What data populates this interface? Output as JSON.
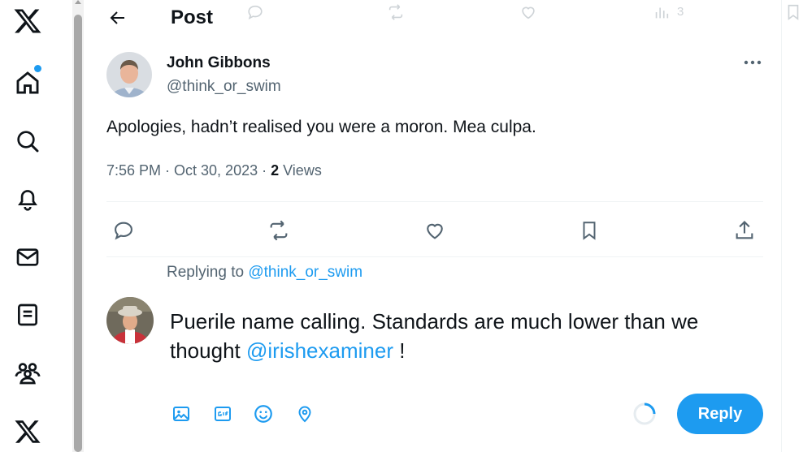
{
  "nav": {
    "items": [
      {
        "name": "x-logo-icon"
      },
      {
        "name": "home-icon"
      },
      {
        "name": "search-icon"
      },
      {
        "name": "notifications-icon"
      },
      {
        "name": "messages-icon"
      },
      {
        "name": "lists-icon"
      },
      {
        "name": "communities-icon"
      },
      {
        "name": "premium-x-icon"
      }
    ],
    "notification_dot_color": "#1d9bf0"
  },
  "header": {
    "title": "Post"
  },
  "ghost_bar": {
    "views_count": "3"
  },
  "tweet": {
    "author_name": "John Gibbons",
    "author_handle": "@think_or_swim",
    "text": "Apologies, hadn’t realised you were a moron. Mea culpa.",
    "time": "7:56 PM · Oct 30, 2023 · ",
    "views_count": "2",
    "views_label": " Views"
  },
  "reply": {
    "replying_to_prefix": "Replying to ",
    "replying_to_handle": "@think_or_swim",
    "text_before": "Puerile name calling. Standards are much lower than we thought  ",
    "mention": "@irishexaminer",
    "text_after": " !",
    "button_label": "Reply"
  },
  "colors": {
    "accent": "#1d9bf0",
    "text": "#0f1419",
    "muted": "#536471"
  }
}
